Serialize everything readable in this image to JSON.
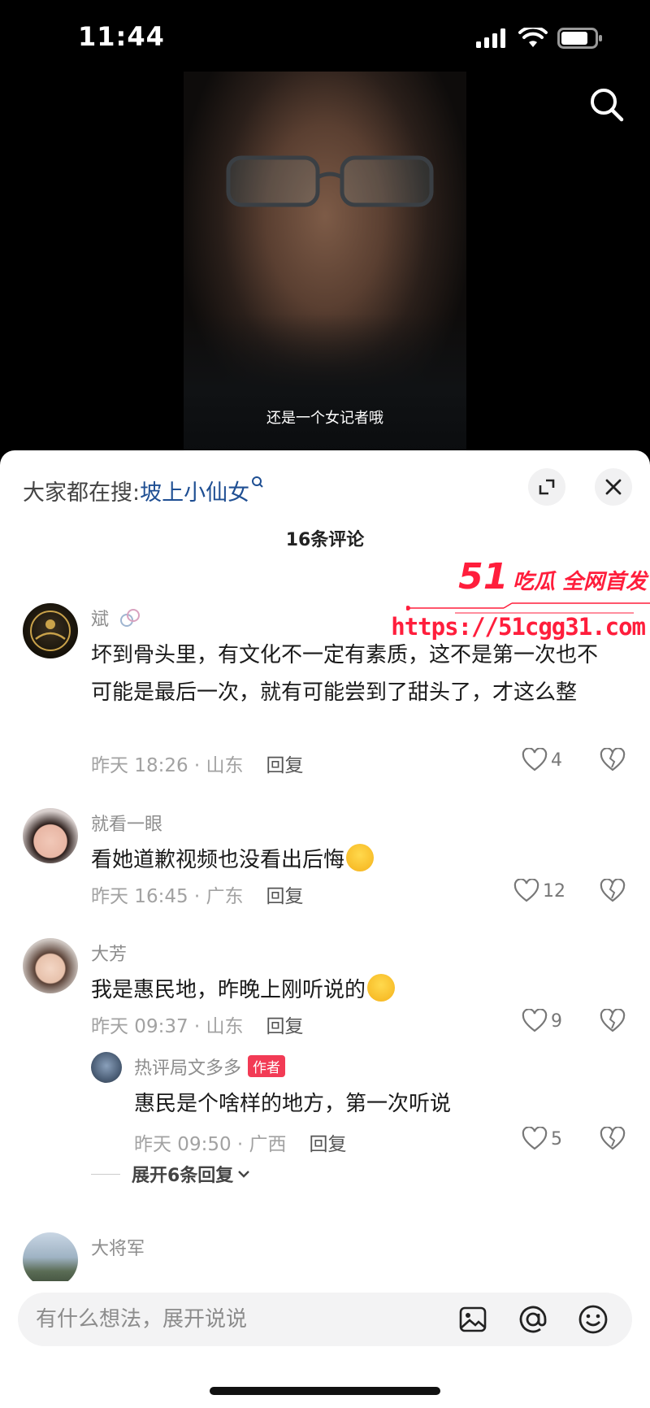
{
  "status_bar": {
    "time": "11:44",
    "icons": [
      "signal-icon",
      "wifi-icon",
      "battery-icon"
    ]
  },
  "video": {
    "caption": "还是一个女记者哦"
  },
  "header": {
    "hot_search_label": "大家都在搜:",
    "hot_search_keyword": "坡上小仙女",
    "comment_count_title": "16条评论"
  },
  "watermark": {
    "brand_number": "51",
    "brand_text": "吃瓜 全网首发",
    "url": "https://51cgg31.com"
  },
  "comments": [
    {
      "name": "斌",
      "text": "坏到骨头里，有文化不一定有素质，这不是第一次也不可能是最后一次，就有可能尝到了甜头了，才这么整",
      "time_location": "昨天 18:26 · 山东",
      "reply_label": "回复",
      "likes": "4"
    },
    {
      "name": "就看一眼",
      "text": "看她道歉视频也没看出后悔",
      "time_location": "昨天 16:45 · 广东",
      "reply_label": "回复",
      "likes": "12"
    },
    {
      "name": "大芳",
      "text": "我是惠民地，昨晚上刚听说的",
      "time_location": "昨天 09:37 · 山东",
      "reply_label": "回复",
      "likes": "9"
    },
    {
      "name": "大将军",
      "text": "",
      "time_location": "",
      "reply_label": "",
      "likes": ""
    }
  ],
  "reply": {
    "name": "热评局文多多",
    "tag": "作者",
    "text": "惠民是个啥样的地方，第一次听说",
    "time_location": "昨天 09:50 · 广西",
    "reply_label": "回复",
    "likes": "5"
  },
  "expand_label": "展开6条回复",
  "input": {
    "placeholder": "有什么想法，展开说说"
  },
  "colors": {
    "accent_keyword": "#1f4f93",
    "author_tag": "#f23b55",
    "watermark": "#ff1e3c"
  }
}
